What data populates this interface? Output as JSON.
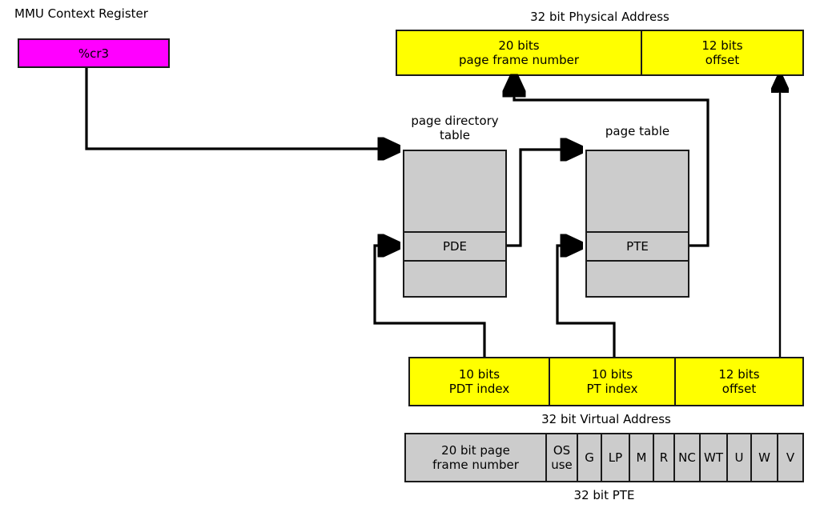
{
  "diagram": {
    "title_mmu": "MMU Context Register",
    "cr3_label": "%cr3",
    "physical_address_caption": "32 bit Physical Address",
    "virtual_address_caption": "32 bit Virtual Address",
    "pte_caption": "32 bit PTE",
    "page_directory_caption_line1": "page directory",
    "page_directory_caption_line2": "table",
    "page_table_caption": "page table",
    "pde_label": "PDE",
    "pte_label": "PTE"
  },
  "physical_address": {
    "fields": [
      {
        "bits": "20 bits",
        "name": "page frame number"
      },
      {
        "bits": "12 bits",
        "name": "offset"
      }
    ]
  },
  "virtual_address": {
    "fields": [
      {
        "bits": "10 bits",
        "name": "PDT index"
      },
      {
        "bits": "10 bits",
        "name": "PT index"
      },
      {
        "bits": "12 bits",
        "name": "offset"
      }
    ]
  },
  "pte_bits": {
    "fields": [
      {
        "line1": "20 bit page",
        "line2": "frame number"
      },
      {
        "line1": "OS",
        "line2": "use"
      },
      {
        "line1": "G",
        "line2": ""
      },
      {
        "line1": "LP",
        "line2": ""
      },
      {
        "line1": "M",
        "line2": ""
      },
      {
        "line1": "R",
        "line2": ""
      },
      {
        "line1": "NC",
        "line2": ""
      },
      {
        "line1": "WT",
        "line2": ""
      },
      {
        "line1": "U",
        "line2": ""
      },
      {
        "line1": "W",
        "line2": ""
      },
      {
        "line1": "V",
        "line2": ""
      }
    ]
  },
  "colors": {
    "address_fill": "#ffff00",
    "table_fill": "#cccccc",
    "register_fill": "#ff00ff",
    "stroke": "#1a1a1a"
  }
}
